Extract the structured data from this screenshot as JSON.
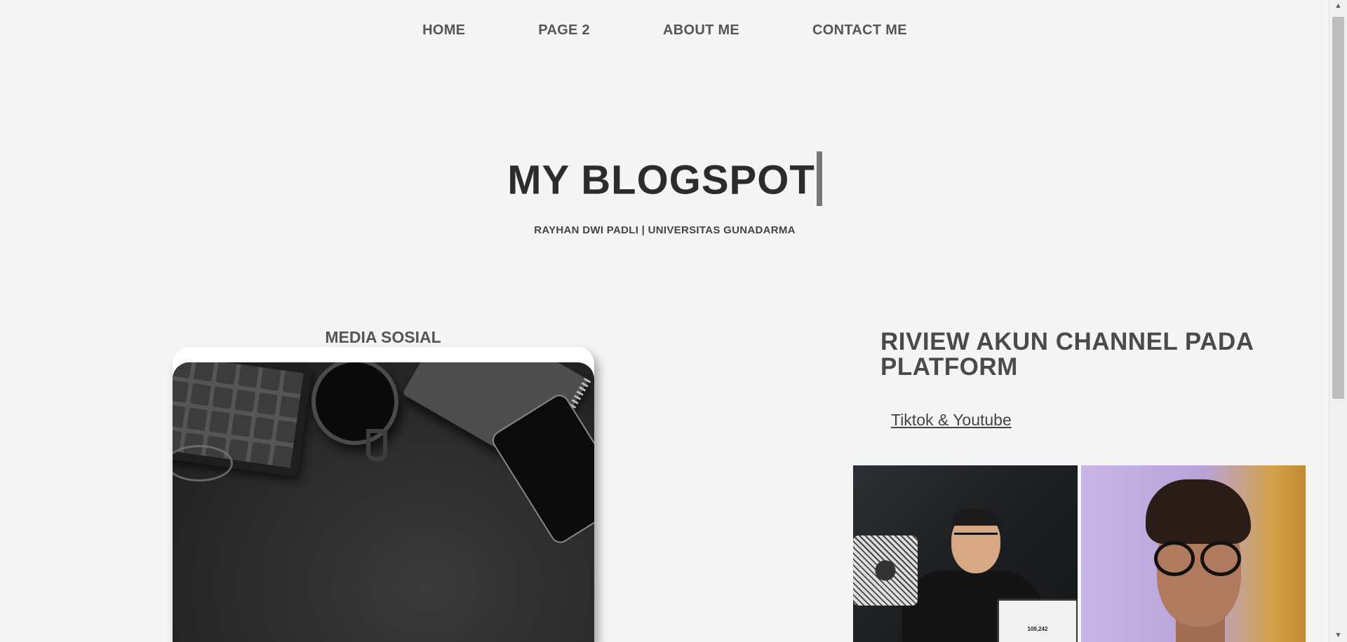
{
  "nav": {
    "items": [
      {
        "label": "HOME"
      },
      {
        "label": "PAGE 2"
      },
      {
        "label": "ABOUT ME"
      },
      {
        "label": "CONTACT ME"
      }
    ]
  },
  "hero": {
    "title": "MY BLOGSPOT",
    "subtitle": "RAYHAN DWI PADLI | UNIVERSITAS GUNADARMA"
  },
  "media": {
    "title": "MEDIA SOSIAL"
  },
  "review": {
    "title": "RIVIEW AKUN CHANNEL PADA PLATFORM",
    "link": "Tiktok & Youtube",
    "laptop_counter": "109,242"
  },
  "scrollbar": {
    "up_icon": "▲",
    "down_icon": "▼"
  }
}
